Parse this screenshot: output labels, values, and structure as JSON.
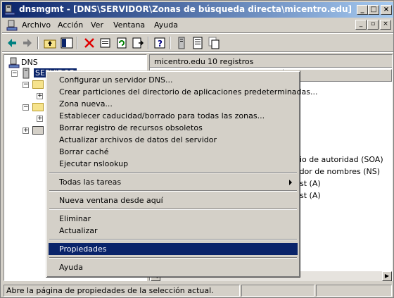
{
  "window": {
    "title": "dnsmgmt - [DNS\\SERVIDOR\\Zonas de búsqueda directa\\micentro.edu]",
    "controls": [
      "minimize",
      "maximize",
      "close"
    ]
  },
  "menubar": {
    "items": [
      "Archivo",
      "Acción",
      "Ver",
      "Ventana",
      "Ayuda"
    ]
  },
  "tree": {
    "root": "DNS",
    "server": "SERVIDOR"
  },
  "rightpane": {
    "header_name": "micentro.edu",
    "header_count": "10 registros",
    "col_partial": "o",
    "rows": [
      "io de autoridad (SOA)",
      "vidor de nombres (NS)",
      "st (A)",
      "st (A)"
    ]
  },
  "context_menu": {
    "items": [
      {
        "label": "Configurar un servidor DNS..."
      },
      {
        "label": "Crear particiones del directorio de aplicaciones predeterminadas..."
      },
      {
        "label": "Zona nueva..."
      },
      {
        "label": "Establecer caducidad/borrado para todas las zonas..."
      },
      {
        "label": "Borrar registro de recursos obsoletos"
      },
      {
        "label": "Actualizar archivos de datos del servidor"
      },
      {
        "label": "Borrar caché"
      },
      {
        "label": "Ejecutar nslookup"
      },
      {
        "label": "Todas las tareas"
      },
      {
        "label": "Nueva ventana desde aquí"
      },
      {
        "label": "Eliminar"
      },
      {
        "label": "Actualizar"
      },
      {
        "label": "Propiedades"
      },
      {
        "label": "Ayuda"
      }
    ]
  },
  "statusbar": {
    "text": "Abre la página de propiedades de la selección actual."
  },
  "colors": {
    "selection": "#0a246a",
    "titlebar_start": "#0a246a",
    "titlebar_end": "#a6caf0",
    "face": "#d4d0c8"
  }
}
